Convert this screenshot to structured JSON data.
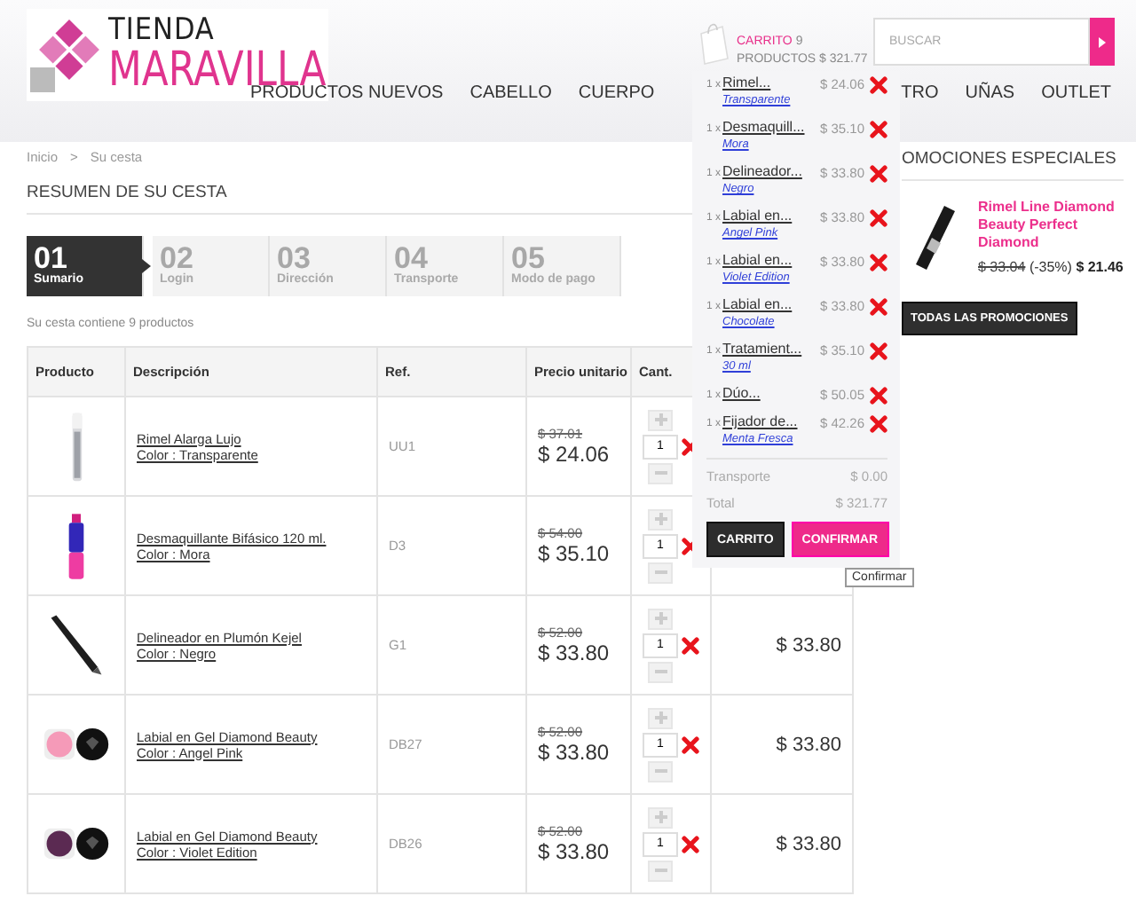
{
  "logo": {
    "line1": "TIENDA",
    "line2": "MARAVILLA"
  },
  "nav": [
    {
      "label": "PRODUCTOS NUEVOS"
    },
    {
      "label": "CABELLO"
    },
    {
      "label": "CUERPO"
    },
    {
      "label": "TRO"
    },
    {
      "label": "UÑAS"
    },
    {
      "label": "OUTLET"
    }
  ],
  "cart": {
    "label": "CARRITO",
    "count": "9",
    "summary": "PRODUCTOS $ 321.77"
  },
  "search": {
    "placeholder": "BUSCAR"
  },
  "breadcrumb": {
    "home": "Inicio",
    "separator": ">",
    "current": "Su cesta"
  },
  "page_title": "RESUMEN DE SU CESTA",
  "steps": [
    {
      "number": "01",
      "label": "Sumario",
      "selected": true
    },
    {
      "number": "02",
      "label": "Login",
      "selected": false
    },
    {
      "number": "03",
      "label": "Dirección",
      "selected": false
    },
    {
      "number": "04",
      "label": "Transporte",
      "selected": false
    },
    {
      "number": "05",
      "label": "Modo de pago",
      "selected": false
    }
  ],
  "cart_summary": "Su cesta contiene 9 productos",
  "table": {
    "columns": [
      "Producto",
      "Descripción",
      "Ref.",
      "Precio unitario",
      "Cant."
    ],
    "rows": [
      {
        "name": "Rimel Alarga Lujo",
        "variant": "Color : Transparente",
        "ref": "UU1",
        "old_price": "$ 37.01",
        "price": "$ 24.06",
        "quantity": "1"
      },
      {
        "name": "Desmaquillante Bifásico 120 ml.",
        "variant": "Color : Mora",
        "ref": "D3",
        "old_price": "$ 54.00",
        "price": "$ 35.10",
        "quantity": "1"
      },
      {
        "name": "Delineador en Plumón Kejel",
        "variant": "Color : Negro",
        "ref": "G1",
        "old_price": "$ 52.00",
        "price": "$ 33.80",
        "quantity": "1",
        "total": "$ 33.80"
      },
      {
        "name": "Labial en Gel Diamond Beauty",
        "variant": "Color : Angel Pink",
        "ref": "DB27",
        "old_price": "$ 52.00",
        "price": "$ 33.80",
        "quantity": "1",
        "total": "$ 33.80"
      },
      {
        "name": "Labial en Gel Diamond Beauty",
        "variant": "Color : Violet Edition",
        "ref": "DB26",
        "old_price": "$ 52.00",
        "price": "$ 33.80",
        "quantity": "1",
        "total": "$ 33.80"
      }
    ]
  },
  "cart_dropdown": {
    "items": [
      {
        "quantity": "1 x",
        "name": "Rimel...",
        "variant": "Transparente",
        "price": "$ 24.06"
      },
      {
        "quantity": "1 x",
        "name": "Desmaquill...",
        "variant": "Mora",
        "price": "$ 35.10"
      },
      {
        "quantity": "1 x",
        "name": "Delineador...",
        "variant": "Negro",
        "price": "$ 33.80"
      },
      {
        "quantity": "1 x",
        "name": "Labial en...",
        "variant": "Angel Pink",
        "price": "$ 33.80"
      },
      {
        "quantity": "1 x",
        "name": "Labial en...",
        "variant": "Violet Edition",
        "price": "$ 33.80"
      },
      {
        "quantity": "1 x",
        "name": "Labial en...",
        "variant": "Chocolate",
        "price": "$ 33.80"
      },
      {
        "quantity": "1 x",
        "name": "Tratamient...",
        "variant": "30 ml",
        "price": "$ 35.10"
      },
      {
        "quantity": "1 x",
        "name": "Dúo...",
        "price": "$ 50.05"
      },
      {
        "quantity": "1 x",
        "name": "Fijador de...",
        "variant": "Menta Fresca",
        "price": "$ 42.26"
      }
    ],
    "shipping": {
      "label": "Transporte",
      "value": "$ 0.00"
    },
    "total": {
      "label": "Total",
      "value": "$ 321.77"
    },
    "buttons": [
      "CARRITO",
      "CONFIRMAR"
    ],
    "tooltip": "Confirmar"
  },
  "promotions": {
    "title": "OMOCIONES ESPECIALES",
    "product": {
      "name": "Rimel Line Diamond Beauty Perfect Diamond",
      "old_price": "$ 33.04",
      "discount": "(-35%)",
      "price": "$ 21.46"
    },
    "button": "TODAS LAS PROMOCIONES"
  }
}
